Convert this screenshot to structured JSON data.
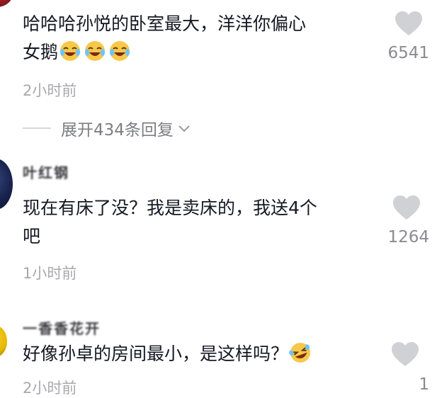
{
  "comments": [
    {
      "username": "",
      "text": "哈哈哈孙悦的卧室最大，洋洋你偏心\n女鹅",
      "emojis": [
        "cry-laugh-emoji",
        "cry-laugh-emoji",
        "cry-laugh-emoji"
      ],
      "time": "2小时前",
      "likes": "6541",
      "replies": "展开434条回复"
    },
    {
      "username": "叶红钢",
      "text": "现在有床了没？我是卖床的，我送4个\n吧",
      "time": "1小时前",
      "likes": "1264"
    },
    {
      "username": "一香香花开",
      "text": "好像孙卓的房间最小，是这样吗？",
      "emojis": [
        "rolling-laugh-emoji"
      ],
      "time": "2小时前",
      "likes": "1"
    }
  ],
  "colors": {
    "text": "#161823",
    "muted": "#a8a9ae",
    "like": "#d0d1d4"
  },
  "icons": {
    "like": "heart-icon",
    "expand": "chevron-down-icon"
  }
}
